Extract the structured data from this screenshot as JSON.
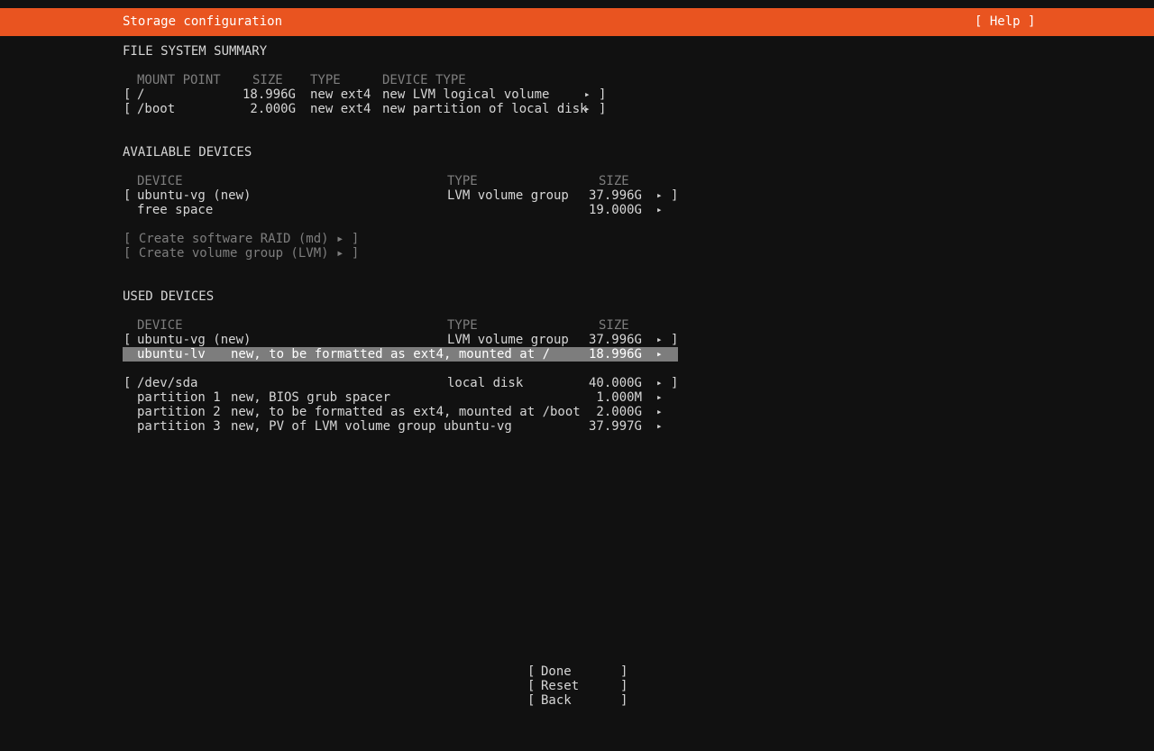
{
  "header": {
    "title": "Storage configuration",
    "help": "[ Help ]"
  },
  "fs_summary": {
    "title": "FILE SYSTEM SUMMARY",
    "columns": {
      "mount": "MOUNT POINT",
      "size": "SIZE",
      "type": "TYPE",
      "device_type": "DEVICE TYPE"
    },
    "rows": [
      {
        "mount": "/",
        "size": "18.996G",
        "type": "new ext4",
        "device_type": "new LVM logical volume"
      },
      {
        "mount": "/boot",
        "size": "2.000G",
        "type": "new ext4",
        "device_type": "new partition of local disk"
      }
    ]
  },
  "available": {
    "title": "AVAILABLE DEVICES",
    "columns": {
      "device": "DEVICE",
      "type": "TYPE",
      "size": "SIZE"
    },
    "rows": [
      {
        "device": "ubuntu-vg (new)",
        "type": "LVM volume group",
        "size": "37.996G"
      },
      {
        "device": "free space",
        "type": "",
        "size": "19.000G"
      }
    ],
    "actions": [
      "[ Create software RAID (md) ▸ ]",
      "[ Create volume group (LVM) ▸ ]"
    ]
  },
  "used": {
    "title": "USED DEVICES",
    "columns": {
      "device": "DEVICE",
      "type": "TYPE",
      "size": "SIZE"
    },
    "groups": [
      {
        "device": "ubuntu-vg (new)",
        "type": "LVM volume group",
        "size": "37.996G",
        "children": [
          {
            "name": "ubuntu-lv",
            "desc": "new, to be formatted as ext4, mounted at /",
            "size": "18.996G"
          }
        ]
      },
      {
        "device": "/dev/sda",
        "type": "local disk",
        "size": "40.000G",
        "children": [
          {
            "name": "partition 1",
            "desc": "new, BIOS grub spacer",
            "size": "1.000M"
          },
          {
            "name": "partition 2",
            "desc": "new, to be formatted as ext4, mounted at /boot",
            "size": "2.000G"
          },
          {
            "name": "partition 3",
            "desc": "new, PV of LVM volume group ubuntu-vg",
            "size": "37.997G"
          }
        ]
      }
    ]
  },
  "footer": {
    "done": "Done",
    "reset": "Reset",
    "back": "Back"
  },
  "symbols": {
    "open": "[",
    "close": "]",
    "arrow": "▸"
  },
  "colors": {
    "header_bg": "#e95420",
    "background": "#111111",
    "text": "#d6d6d6",
    "highlight": "#7d7d7d",
    "disabled": "#7e7e7e"
  }
}
